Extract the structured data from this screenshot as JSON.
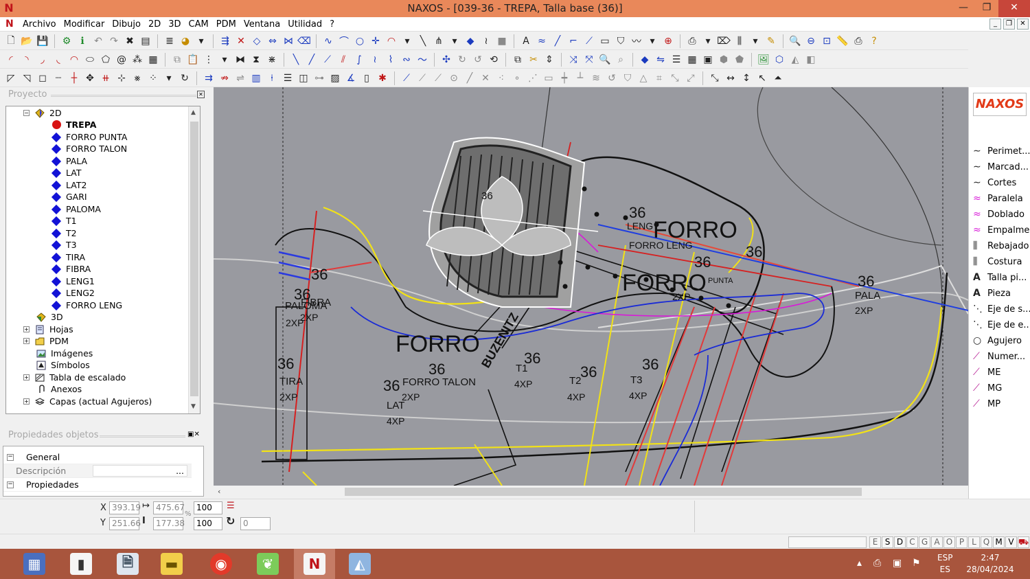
{
  "window": {
    "title": "NAXOS - [039-36 - TREPA, Talla base (36)]",
    "minimize": "—",
    "maximize": "❐",
    "close": "✕"
  },
  "menu": {
    "items": [
      "Archivo",
      "Modificar",
      "Dibujo",
      "2D",
      "3D",
      "CAM",
      "PDM",
      "Ventana",
      "Utilidad",
      "?"
    ],
    "mdi_minimize": "_",
    "mdi_restore": "❐",
    "mdi_close": "✕"
  },
  "project_panel": {
    "title": "Proyecto",
    "tree": [
      {
        "label": "2D",
        "icon": "gem-icon",
        "expander": "−",
        "level": 0
      },
      {
        "label": "TREPA",
        "icon": "red-dot-icon",
        "level": 1,
        "selected": true
      },
      {
        "label": "FORRO PUNTA",
        "icon": "blue-diamond-icon",
        "level": 1
      },
      {
        "label": "FORRO TALON",
        "icon": "blue-diamond-icon",
        "level": 1
      },
      {
        "label": "PALA",
        "icon": "blue-diamond-icon",
        "level": 1
      },
      {
        "label": "LAT",
        "icon": "blue-diamond-icon",
        "level": 1
      },
      {
        "label": "LAT2",
        "icon": "blue-diamond-icon",
        "level": 1
      },
      {
        "label": "GARI",
        "icon": "blue-diamond-icon",
        "level": 1
      },
      {
        "label": "PALOMA",
        "icon": "blue-diamond-icon",
        "level": 1
      },
      {
        "label": "T1",
        "icon": "blue-diamond-icon",
        "level": 1
      },
      {
        "label": "T2",
        "icon": "blue-diamond-icon",
        "level": 1
      },
      {
        "label": "T3",
        "icon": "blue-diamond-icon",
        "level": 1
      },
      {
        "label": "TIRA",
        "icon": "blue-diamond-icon",
        "level": 1
      },
      {
        "label": "FIBRA",
        "icon": "blue-diamond-icon",
        "level": 1
      },
      {
        "label": "LENG1",
        "icon": "blue-diamond-icon",
        "level": 1
      },
      {
        "label": "LENG2",
        "icon": "blue-diamond-icon",
        "level": 1
      },
      {
        "label": "FORRO LENG",
        "icon": "blue-diamond-icon",
        "level": 1
      },
      {
        "label": "3D",
        "icon": "gem3d-icon",
        "level": 0
      },
      {
        "label": "Hojas",
        "icon": "sheets-icon",
        "expander": "+",
        "level": 0
      },
      {
        "label": "PDM",
        "icon": "folder-icon",
        "expander": "+",
        "level": 0
      },
      {
        "label": "Imágenes",
        "icon": "image-icon",
        "level": 0
      },
      {
        "label": "Símbolos",
        "icon": "symbol-icon",
        "level": 0
      },
      {
        "label": "Tabla de escalado",
        "icon": "table-icon",
        "expander": "+",
        "level": 0
      },
      {
        "label": "Anexos",
        "icon": "paperclip-icon",
        "level": 0
      },
      {
        "label": "Capas (actual Agujeros)",
        "icon": "layers-icon",
        "expander": "+",
        "level": 0
      }
    ]
  },
  "properties_panel": {
    "title": "Propiedades objetos",
    "rows": [
      {
        "label": "General",
        "expander": "−"
      },
      {
        "label": "Descripción",
        "value": "...",
        "sub": true
      },
      {
        "label": "Propiedades",
        "expander": "−"
      }
    ]
  },
  "canvas": {
    "labels": {
      "forro_big": "FORRO",
      "forro_right_1": "FORRO",
      "forro_right_2": "FORRO",
      "s36_a": "36",
      "s36_b": "36",
      "s36_c": "36",
      "s36_d": "36",
      "s36_e": "36",
      "s36_f": "36",
      "s36_g": "36",
      "s36_h": "36",
      "s36_i": "36",
      "s36_j": "36",
      "s36_k": "36",
      "s36_l": "36",
      "s36_m": "36",
      "s36_n": "36",
      "leng": "LENG",
      "forro_leng": "FORRO LENG",
      "punta": "PUNTA",
      "forro_talon": "FORRO TALON",
      "pala": "PALA",
      "lat": "LAT",
      "tira": "TIRA",
      "fibra": "FIBRA",
      "paloma": "PALOMA",
      "t1": "T1",
      "t2": "T2",
      "t3": "T3",
      "buzenitz": "BUZENITZ",
      "x2p_a": "2XP",
      "x2p_b": "2XP",
      "x2p_c": "2XP",
      "x2p_d": "2XP",
      "x2p_e": "2XP",
      "x4p_a": "4XP",
      "x4p_b": "4XP",
      "x4p_c": "4XP",
      "x4p_d": "4XP",
      "x2p_tira": "2XP"
    }
  },
  "right_palette": {
    "logo": "NAXOS",
    "items": [
      {
        "label": "Perimet...",
        "icon": "curve-icon"
      },
      {
        "label": "Marcad...",
        "icon": "curve-icon"
      },
      {
        "label": "Cortes",
        "icon": "curve-icon"
      },
      {
        "label": "Paralela",
        "icon": "parallel-icon"
      },
      {
        "label": "Doblado",
        "icon": "fold-icon"
      },
      {
        "label": "Empalme",
        "icon": "join-icon"
      },
      {
        "label": "Rebajado",
        "icon": "skive-icon"
      },
      {
        "label": "Costura",
        "icon": "stitch-icon"
      },
      {
        "label": "Talla pi...",
        "icon": "text-a-icon"
      },
      {
        "label": "Pieza",
        "icon": "text-a-icon"
      },
      {
        "label": "Eje de s...",
        "icon": "axis-icon"
      },
      {
        "label": "Eje de e...",
        "icon": "axis-icon"
      },
      {
        "label": "Agujero",
        "icon": "circle-icon"
      },
      {
        "label": "Numer...",
        "icon": "pen-icon"
      },
      {
        "label": "ME",
        "icon": "pen-icon"
      },
      {
        "label": "MG",
        "icon": "pen-icon"
      },
      {
        "label": "MP",
        "icon": "pen-icon"
      }
    ]
  },
  "coords": {
    "x_label": "X",
    "y_label": "Y",
    "x_value": "393.19",
    "y_value": "251.66",
    "width_value": "475.67",
    "height_value": "177.38",
    "scale_x": "100",
    "scale_y": "100",
    "percent": "%",
    "rotation": "0"
  },
  "status": {
    "letters": [
      "E",
      "S",
      "D",
      "C",
      "G",
      "A",
      "O",
      "P",
      "L",
      "Q",
      "M",
      "V"
    ]
  },
  "taskbar": {
    "lang_top": "ESP",
    "lang_bottom": "ES",
    "time": "2:47",
    "date": "28/04/2024"
  }
}
